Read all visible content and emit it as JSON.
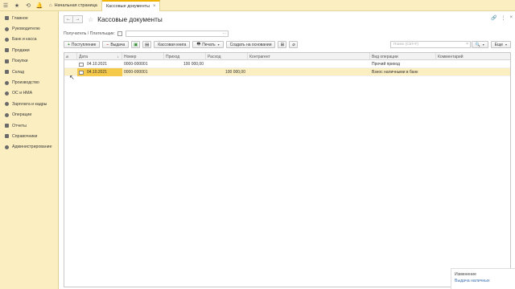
{
  "topbar": {
    "tabs": [
      {
        "label": "Начальная страница"
      },
      {
        "label": "Кассовые документы"
      }
    ]
  },
  "sidebar": {
    "items": [
      {
        "label": "Главное"
      },
      {
        "label": "Руководителю"
      },
      {
        "label": "Банк и касса"
      },
      {
        "label": "Продажи"
      },
      {
        "label": "Покупки"
      },
      {
        "label": "Склад"
      },
      {
        "label": "Производство"
      },
      {
        "label": "ОС и НМА"
      },
      {
        "label": "Зарплата и кадры"
      },
      {
        "label": "Операции"
      },
      {
        "label": "Отчеты"
      },
      {
        "label": "Справочники"
      },
      {
        "label": "Администрирование"
      }
    ]
  },
  "main": {
    "title": "Кассовые документы",
    "filter": {
      "label": "Получатель / Плательщик:",
      "dots": "..."
    },
    "toolbar": {
      "receipt": "Поступление",
      "payout": "Выдача",
      "cash_book": "Кассовая книга",
      "print": "Печать",
      "create_based": "Создать на основании",
      "more": "Еще"
    },
    "search": {
      "placeholder": "Поиск (Ctrl+F)"
    },
    "table": {
      "columns": [
        "Дата",
        "Номер",
        "Приход",
        "Расход",
        "Контрагент",
        "Вид операции",
        "Комментарий"
      ],
      "rows": [
        {
          "date": "04.10.2021",
          "number": "0000-000001",
          "income": "100 000,00",
          "expense": "",
          "counterparty": "",
          "operation": "Прочий приход",
          "comment": "",
          "selected": false
        },
        {
          "date": "04.10.2021",
          "number": "0000-000001",
          "income": "",
          "expense": "100 000,00",
          "counterparty": "",
          "operation": "Взнос наличными в банк",
          "comment": "",
          "selected": true
        }
      ]
    }
  },
  "notification": {
    "title": "Изменение",
    "link": "Выдача наличных"
  }
}
